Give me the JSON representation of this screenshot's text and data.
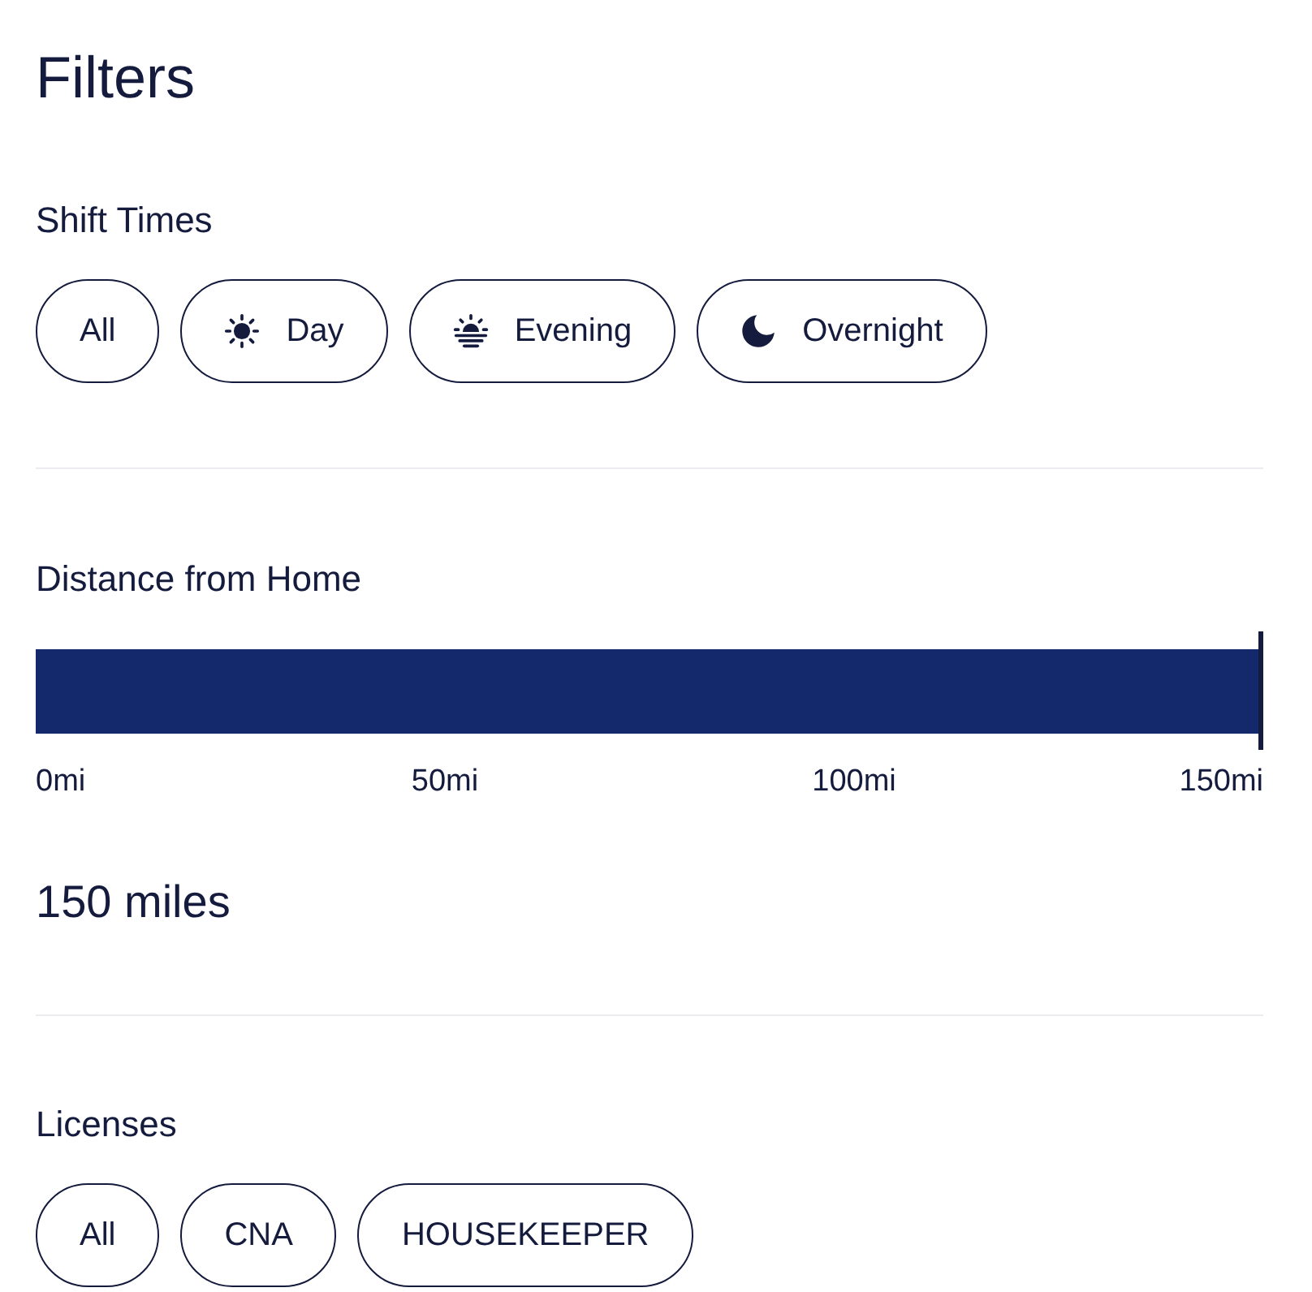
{
  "title": "Filters",
  "shift_times": {
    "heading": "Shift Times",
    "options": [
      {
        "label": "All",
        "kind": "plain",
        "selected": false
      },
      {
        "label": "Day",
        "kind": "day",
        "selected": false
      },
      {
        "label": "Evening",
        "kind": "evening",
        "selected": false
      },
      {
        "label": "Overnight",
        "kind": "overnight",
        "selected": false
      }
    ]
  },
  "distance": {
    "heading": "Distance from Home",
    "level": 1,
    "ticks": [
      "0mi",
      "50mi",
      "100mi",
      "150mi"
    ],
    "reading": "150 miles"
  },
  "licenses": {
    "heading": "Licenses",
    "options": [
      {
        "label": "All",
        "selected": false
      },
      {
        "label": "CNA",
        "selected": false
      },
      {
        "label": "HOUSEKEEPER",
        "selected": false
      }
    ]
  }
}
